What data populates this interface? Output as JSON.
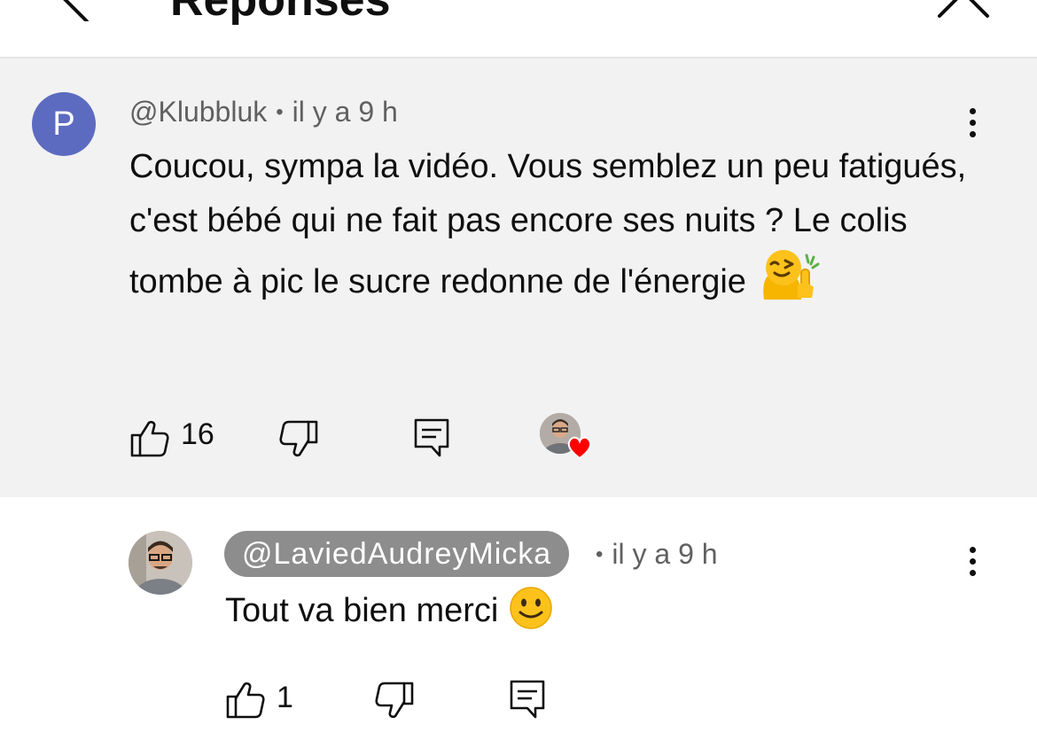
{
  "header": {
    "title": "Réponses",
    "back_icon": "chevron-left-icon",
    "close_icon": "close-icon"
  },
  "parent_comment": {
    "avatar_letter": "P",
    "avatar_color": "#5c6bc0",
    "author": "@Klubbluk",
    "separator": "•",
    "time": "il y a 9 h",
    "text": "Coucou, sympa la vidéo. Vous semblez un peu fatigués, c'est bébé qui ne fait pas encore ses nuits ? Le colis tombe à pic le sucre redonne de l'énergie",
    "emoji": "hugging-face-emoji",
    "like_count": "16",
    "creator_hearted": true,
    "heart_color": "#ff0000",
    "background": "#f2f2f2"
  },
  "reply_comment": {
    "author": "@LaviedAudreyMicka",
    "separator": "•",
    "time": "il y a 9 h",
    "text": "Tout va bien merci",
    "emoji": "slightly-smiling-face-emoji",
    "like_count": "1",
    "pill_color": "#8d8d8d"
  },
  "icons": {
    "like": "thumb-up-icon",
    "dislike": "thumb-down-icon",
    "reply": "reply-comment-icon",
    "more": "more-vertical-icon"
  }
}
